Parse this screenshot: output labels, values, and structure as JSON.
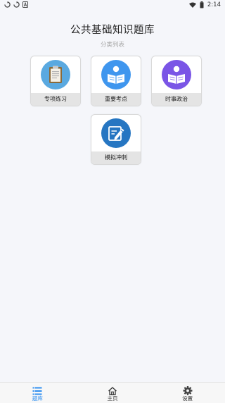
{
  "status_bar": {
    "time": "2:14",
    "icons": [
      "sync-icon",
      "sync-icon",
      "notification-a-icon",
      "wifi-icon",
      "battery-icon"
    ]
  },
  "header": {
    "title": "公共基础知识题库",
    "subtitle": "分类列表"
  },
  "categories": [
    {
      "label": "专项练习",
      "icon": "clipboard-icon",
      "color": "#5aa9e0"
    },
    {
      "label": "重要考点",
      "icon": "reading-person-icon",
      "color": "#3f96ee"
    },
    {
      "label": "时事政治",
      "icon": "reading-person-icon",
      "color": "#7a55e6"
    },
    {
      "label": "模拟冲刺",
      "icon": "edit-note-icon",
      "color": "#2676c2"
    }
  ],
  "bottom_nav": {
    "items": [
      {
        "label": "题库",
        "icon": "list-icon",
        "active": true
      },
      {
        "label": "主页",
        "icon": "home-icon",
        "active": false
      },
      {
        "label": "设置",
        "icon": "gear-icon",
        "active": false
      }
    ],
    "active_color": "#2f8ff0"
  }
}
